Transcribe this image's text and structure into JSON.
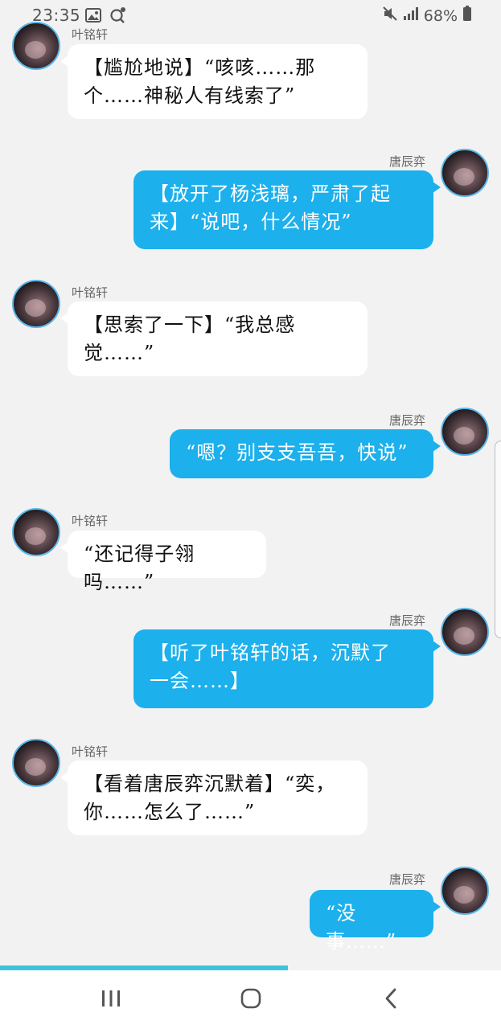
{
  "status_bar": {
    "time": "23:35",
    "battery": "68%",
    "icons": [
      "image-icon",
      "search-location-icon",
      "mute-icon",
      "signal-icon",
      "battery-icon"
    ]
  },
  "messages": [
    {
      "sender": "叶铭轩",
      "side": "left",
      "lines": [
        "【尴尬地说】“咳咳……那",
        "个……神秘人有线索了”"
      ]
    },
    {
      "sender": "唐辰弈",
      "side": "right",
      "lines": [
        "【放开了杨浅璃，严肃了起",
        "来】“说吧，什么情况”"
      ]
    },
    {
      "sender": "叶铭轩",
      "side": "left",
      "lines": [
        "【思索了一下】“我总感",
        "觉……”"
      ]
    },
    {
      "sender": "唐辰弈",
      "side": "right",
      "lines": [
        "“嗯？别支支吾吾，快说”"
      ]
    },
    {
      "sender": "叶铭轩",
      "side": "left",
      "lines": [
        "“还记得子翎吗……”"
      ]
    },
    {
      "sender": "唐辰弈",
      "side": "right",
      "lines": [
        "【听了叶铭轩的话，沉默了",
        "一会……】"
      ]
    },
    {
      "sender": "叶铭轩",
      "side": "left",
      "lines": [
        "【看着唐辰弈沉默着】“奕，",
        "你……怎么了……”"
      ]
    },
    {
      "sender": "唐辰弈",
      "side": "right",
      "lines": [
        "“没事……”"
      ]
    }
  ],
  "reading_progress": 0.575,
  "colors": {
    "right_bubble": "#1cb0ec",
    "left_bubble": "#ffffff",
    "avatar_ring": "#5bb7ea",
    "progress": "#3fc3dd"
  },
  "nav": {
    "icons": [
      "recent-apps-icon",
      "home-icon",
      "back-icon"
    ]
  }
}
